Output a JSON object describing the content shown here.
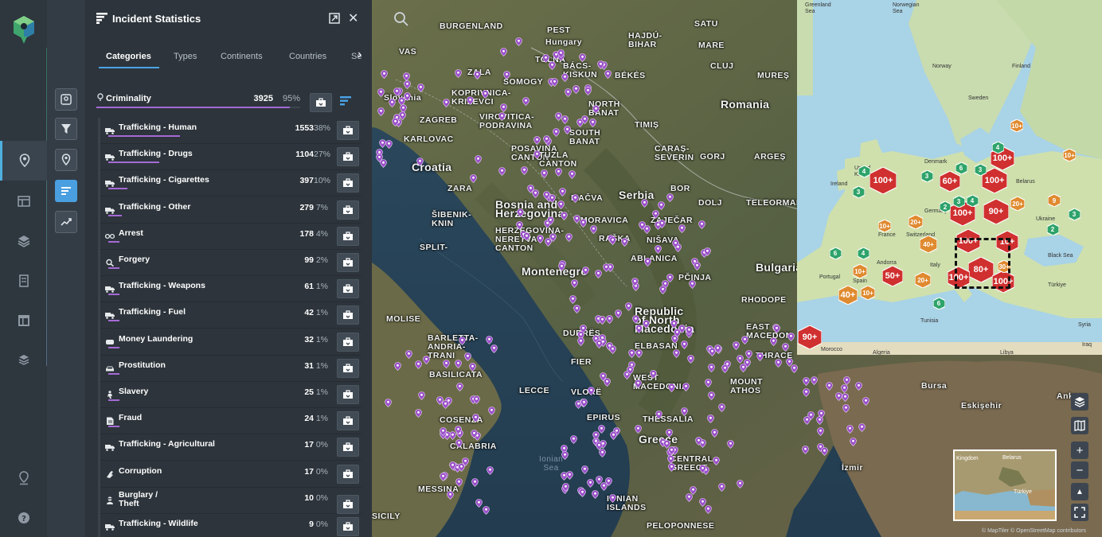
{
  "panel": {
    "title": "Incident Statistics",
    "tabs": [
      {
        "label": "Categories",
        "active": true
      },
      {
        "label": "Types",
        "active": false
      },
      {
        "label": "Continents",
        "active": false
      },
      {
        "label": "Countries",
        "active": false
      },
      {
        "label": "Se",
        "active": false
      }
    ],
    "category": {
      "label": "Criminality",
      "count": "3925",
      "percent": "95%",
      "fraction": 0.95
    },
    "items": [
      {
        "label": "Trafficking - Human",
        "count": "1553",
        "percent": "38%",
        "fraction": 0.38,
        "icon": "truck-icon"
      },
      {
        "label": "Trafficking - Drugs",
        "count": "1104",
        "percent": "27%",
        "fraction": 0.27,
        "icon": "truck-icon"
      },
      {
        "label": "Trafficking - Cigarettes",
        "count": "397",
        "percent": "10%",
        "fraction": 0.1,
        "icon": "truck-icon"
      },
      {
        "label": "Trafficking - Other",
        "count": "279",
        "percent": "7%",
        "fraction": 0.07,
        "icon": "truck-icon"
      },
      {
        "label": "Arrest",
        "count": "178",
        "percent": "4%",
        "fraction": 0.04,
        "icon": "handcuffs-icon"
      },
      {
        "label": "Forgery",
        "count": "99",
        "percent": "2%",
        "fraction": 0.02,
        "icon": "magnifier-icon"
      },
      {
        "label": "Trafficking - Weapons",
        "count": "61",
        "percent": "1%",
        "fraction": 0.01,
        "icon": "truck-icon"
      },
      {
        "label": "Trafficking - Fuel",
        "count": "42",
        "percent": "1%",
        "fraction": 0.01,
        "icon": "truck-icon"
      },
      {
        "label": "Money Laundering",
        "count": "32",
        "percent": "1%",
        "fraction": 0.01,
        "icon": "money-icon"
      },
      {
        "label": "Prostitution",
        "count": "31",
        "percent": "1%",
        "fraction": 0.01,
        "icon": "car-icon"
      },
      {
        "label": "Slavery",
        "count": "25",
        "percent": "1%",
        "fraction": 0.01,
        "icon": "person-icon"
      },
      {
        "label": "Fraud",
        "count": "24",
        "percent": "1%",
        "fraction": 0.01,
        "icon": "document-icon"
      },
      {
        "label": "Trafficking - Agricultural",
        "count": "17",
        "percent": "0%",
        "fraction": 0.0,
        "icon": "truck-icon"
      },
      {
        "label": "Corruption",
        "count": "17",
        "percent": "0%",
        "fraction": 0.0,
        "icon": "hand-icon"
      },
      {
        "label": "Burglary / Theft",
        "label_line1": "Burglary /",
        "label_line2": "Theft",
        "count": "10",
        "percent": "0%",
        "fraction": 0.0,
        "icon": "thief-icon"
      },
      {
        "label": "Trafficking - Wildlife",
        "count": "9",
        "percent": "0%",
        "fraction": 0.0,
        "icon": "truck-icon"
      }
    ]
  },
  "map": {
    "labels": {
      "burgenland": "BURGENLAND",
      "pest": "PEST",
      "hungary": "Hungary",
      "hajdu_bihar": "HAJDÚ-\nBIHAR",
      "vas": "VAS",
      "zala": "ZALA",
      "somogy": "SOMOGY",
      "tolna": "TOLNA",
      "bacs": "BÁCS-\nKISKUN",
      "bekes": "BÉKÉS",
      "satu": "SATU",
      "mare": "MARE",
      "cluj": "CLUJ",
      "mures": "MUREȘ",
      "romania": "Romania",
      "slovenia": "Slovenia",
      "koprivnica": "KOPRIVNICA-\nKRIŽEVCI",
      "north_banat": "NORTH\nBANAT",
      "zagreb": "ZAGREB",
      "virovitica": "VIROVITICA-\nPODRAVINA",
      "south_banat": "SOUTH\nBANAT",
      "timis": "TIMIȘ",
      "karlovac": "KARLOVAC",
      "posavina": "POSAVINA\nCANTON",
      "caras": "CARAȘ-\nSEVERIN",
      "gorj": "GORJ",
      "arges": "ARGEȘ",
      "croatia": "Croatia",
      "tuzla": "TUZLA\nCANTON",
      "zara": "ZARA",
      "macva": "MAČVA",
      "serbia": "Serbia",
      "bor": "BOR",
      "dolj": "DOLJ",
      "teleorman": "TELEORMAN",
      "bosnia": "Bosnia and\nHerzegovina",
      "sibenik": "ŠIBENIK-\nKNIN",
      "moravica": "MORAVICA",
      "zajecar": "ZAJEČAR",
      "herzegovina_neretva": "HERZEGOVINA-\nNERETVA\nCANTON",
      "rasa": "RAŠKA",
      "nisava": "NIŠAVA",
      "split": "SPLIT-",
      "bulgaria": "Bulgaria",
      "montenegro": "Montenegro",
      "kolubara": "ABLANICA",
      "pcinja": "PČINJA",
      "rhodope": "RHODOPE",
      "molise": "MOLISE",
      "durres": "DURRËS",
      "republic": "Republic\nof North\nMacedonia",
      "east_mac": "EAST\nMACEDON",
      "barletta": "BARLETTA-\nANDRIA-\nTRANI",
      "elbasan": "ELBASAN",
      "basilicata": "BASILICATA",
      "thrace": "THRACE",
      "fier": "FIER",
      "west_mac": "WEST\nMACEDONIA",
      "mount": "MOUNT\nATHOS",
      "lecce": "LECCE",
      "vlore": "VLORË",
      "epirus": "EPIRUS",
      "thessalia": "THESSALIA",
      "cosenza": "COSENZA",
      "greece": "Greece",
      "calabria": "CALABRIA",
      "central": "CENTRAL\nGREECE",
      "messina": "MESSINA",
      "ionian": "IONIAN\nISLANDS",
      "sicily": "SICILY",
      "peloponnese": "PELOPONNESE",
      "bursa": "Bursa",
      "eskisehir": "Eskişehir",
      "ankara": "Ankara",
      "izmir": "İzmir",
      "ionian_sea": "Ionian\nSea"
    },
    "inset_labels": {
      "norwegian_sea": "Norwegian\nSea",
      "norway": "Norway",
      "finland": "Finland",
      "sweden": "Sweden",
      "denmark": "Denmark",
      "united_kingdom": "United\nKingdom",
      "ireland": "Ireland",
      "germany": "Germany",
      "belarus": "Belarus",
      "france": "France",
      "ukraine": "Ukraine",
      "italy": "Italy",
      "spain": "Spain",
      "portugal": "Portugal",
      "black_sea": "Black Sea",
      "turkiye": "Türkiye",
      "tunisia": "Tunisia",
      "morocco": "Morocco",
      "algeria": "Algeria",
      "libya": "Libya",
      "syria": "Syria",
      "iraq": "Iraq",
      "greenland_sea": "Greenland\nSea",
      "andorra": "Andorra",
      "switzerland": "Switzerland"
    },
    "clusters": [
      {
        "label": "100+",
        "color": "#d03030",
        "kind": "hex"
      },
      {
        "label": "60+",
        "color": "#d03030",
        "kind": "hex"
      },
      {
        "label": "100+",
        "color": "#d03030",
        "kind": "hex"
      },
      {
        "label": "100+",
        "color": "#d03030",
        "kind": "hex"
      },
      {
        "label": "100+",
        "color": "#d03030",
        "kind": "hex"
      },
      {
        "label": "90+",
        "color": "#d03030",
        "kind": "hex"
      },
      {
        "label": "100+",
        "color": "#d03030",
        "kind": "hex"
      },
      {
        "label": "10+",
        "color": "#d03030",
        "kind": "hex"
      },
      {
        "label": "80+",
        "color": "#d03030",
        "kind": "hex"
      },
      {
        "label": "100+",
        "color": "#d03030",
        "kind": "hex"
      },
      {
        "label": "100+",
        "color": "#d03030",
        "kind": "hex"
      },
      {
        "label": "50+",
        "color": "#d03030",
        "kind": "hex"
      },
      {
        "label": "90+",
        "color": "#d03030",
        "kind": "hex"
      },
      {
        "label": "40+",
        "color": "#e08a30",
        "kind": "hex"
      },
      {
        "label": "40+",
        "color": "#e08a30",
        "kind": "hex"
      },
      {
        "label": "20+",
        "color": "#e08a30",
        "kind": "hex"
      },
      {
        "label": "20+",
        "color": "#e08a30",
        "kind": "hex"
      },
      {
        "label": "20+",
        "color": "#e08a30",
        "kind": "hex"
      },
      {
        "label": "10+",
        "color": "#e08a30",
        "kind": "hex"
      },
      {
        "label": "10+",
        "color": "#e08a30",
        "kind": "hex"
      },
      {
        "label": "10+",
        "color": "#e08a30",
        "kind": "hex"
      },
      {
        "label": "10+",
        "color": "#e08a30",
        "kind": "hex"
      },
      {
        "label": "10+",
        "color": "#e08a30",
        "kind": "hex"
      },
      {
        "label": "30+",
        "color": "#e08a30",
        "kind": "hex"
      },
      {
        "label": "9",
        "color": "#e08a30",
        "kind": "hex"
      },
      {
        "label": "4",
        "color": "#2ea36a",
        "kind": "hex"
      },
      {
        "label": "3",
        "color": "#2ea36a",
        "kind": "hex"
      },
      {
        "label": "6",
        "color": "#2ea36a",
        "kind": "hex"
      },
      {
        "label": "3",
        "color": "#2ea36a",
        "kind": "hex"
      },
      {
        "label": "4",
        "color": "#2ea36a",
        "kind": "hex"
      },
      {
        "label": "4",
        "color": "#2ea36a",
        "kind": "hex"
      },
      {
        "label": "3",
        "color": "#2ea36a",
        "kind": "hex"
      },
      {
        "label": "6",
        "color": "#2ea36a",
        "kind": "hex"
      },
      {
        "label": "4",
        "color": "#2ea36a",
        "kind": "hex"
      },
      {
        "label": "3",
        "color": "#2ea36a",
        "kind": "hex"
      },
      {
        "label": "2",
        "color": "#2ea36a",
        "kind": "hex"
      },
      {
        "label": "6",
        "color": "#2ea36a",
        "kind": "hex"
      },
      {
        "label": "3",
        "color": "#2ea36a",
        "kind": "hex"
      },
      {
        "label": "2",
        "color": "#2ea36a",
        "kind": "hex"
      }
    ],
    "minimap_labels": {
      "belarus": "Belarus",
      "kingdom": "Kingdom",
      "turkiye": "Türkiye"
    },
    "attribution": "© MapTiler © OpenStreetMap contributors",
    "colors": {
      "accent": "#4aa3e6",
      "bar": "#a56ad6",
      "pin": "#9b4fc9"
    }
  }
}
